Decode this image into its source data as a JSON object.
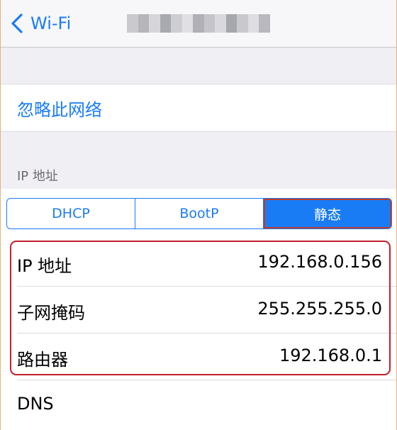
{
  "navbar": {
    "back_label": "Wi-Fi",
    "network_name_obscured": true
  },
  "forget_network": {
    "label": "忽略此网络"
  },
  "ip_section": {
    "header": "IP 地址",
    "modes": [
      {
        "label": "DHCP",
        "selected": false
      },
      {
        "label": "BootP",
        "selected": false
      },
      {
        "label": "静态",
        "selected": true
      }
    ]
  },
  "static_config": [
    {
      "label": "IP 地址",
      "value": "192.168.0.156"
    },
    {
      "label": "子网掩码",
      "value": "255.255.255.0"
    },
    {
      "label": "路由器",
      "value": "192.168.0.1"
    }
  ],
  "dns": {
    "label": "DNS"
  },
  "colors": {
    "accent": "#1a7cf5",
    "background": "#efeff4",
    "highlight": "#c0202c"
  },
  "icons": {
    "back": "chevron-left-icon"
  }
}
